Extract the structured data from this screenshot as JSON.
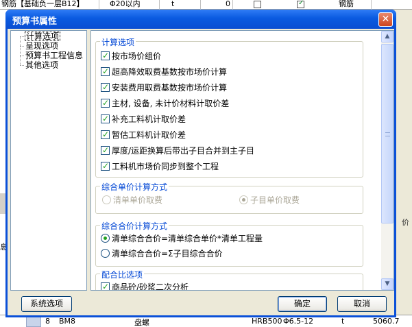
{
  "background": {
    "top_row": {
      "code": "钢筋【基础负一层B12】",
      "spec": "Φ20以内",
      "unit": "t",
      "qty": "0",
      "checkbox1_checked": false,
      "checkbox2_checked": true,
      "category": "钢筋"
    },
    "left_edge_char": "息",
    "right_edge_char": "价",
    "bottom_row": {
      "row_no": "8",
      "code": "BM8",
      "name": "盘螺",
      "model": "HRB500",
      "spec": "Φ6.5-12",
      "unit": "t",
      "value": "5060.7"
    }
  },
  "dialog": {
    "title": "预算书属性",
    "close_icon": "close-icon",
    "tree": {
      "items": [
        {
          "label": "计算选项",
          "selected": true
        },
        {
          "label": "呈现选项",
          "selected": false
        },
        {
          "label": "预算书工程信息",
          "selected": false
        },
        {
          "label": "其他选项",
          "selected": false
        }
      ]
    },
    "groups": {
      "calc": {
        "title": "计算选项",
        "options": [
          {
            "label": "按市场价组价",
            "checked": true
          },
          {
            "label": "超高降效取费基数按市场价计算",
            "checked": true
          },
          {
            "label": "安装费用取费基数按市场价计算",
            "checked": true
          },
          {
            "label": "主材, 设备, 未计价材料计取价差",
            "checked": true
          },
          {
            "label": "补充工料机计取价差",
            "checked": true
          },
          {
            "label": "暂估工料机计取价差",
            "checked": true
          },
          {
            "label": "厚度/运距换算后带出子目合并到主子目",
            "checked": true
          },
          {
            "label": "工料机市场价同步到整个工程",
            "checked": true
          }
        ]
      },
      "unit_price": {
        "title": "综合单价计算方式",
        "options": [
          {
            "label": "清单单价取费",
            "selected": false,
            "disabled": true
          },
          {
            "label": "子目单价取费",
            "selected": true,
            "disabled": true
          }
        ]
      },
      "total_price": {
        "title": "综合合价计算方式",
        "options": [
          {
            "label": "清单综合合价=清单综合单价*清单工程量",
            "selected": true
          },
          {
            "label": "清单综合合价=Σ子目综合合价",
            "selected": false
          }
        ]
      },
      "mix": {
        "title": "配合比选项",
        "options": [
          {
            "label": "商品砼/砂浆二次分析",
            "checked": true
          }
        ]
      }
    },
    "scrollbar": {
      "up_icon": "scroll-up-icon",
      "down_icon": "scroll-down-icon"
    },
    "buttons": {
      "system_options": "系统选项",
      "ok": "确定",
      "cancel": "取消"
    }
  },
  "colors": {
    "titlebar": "#0a5ae0",
    "group_title": "#0046d5",
    "check_mark": "#21a121",
    "close_button": "#cc4520"
  }
}
